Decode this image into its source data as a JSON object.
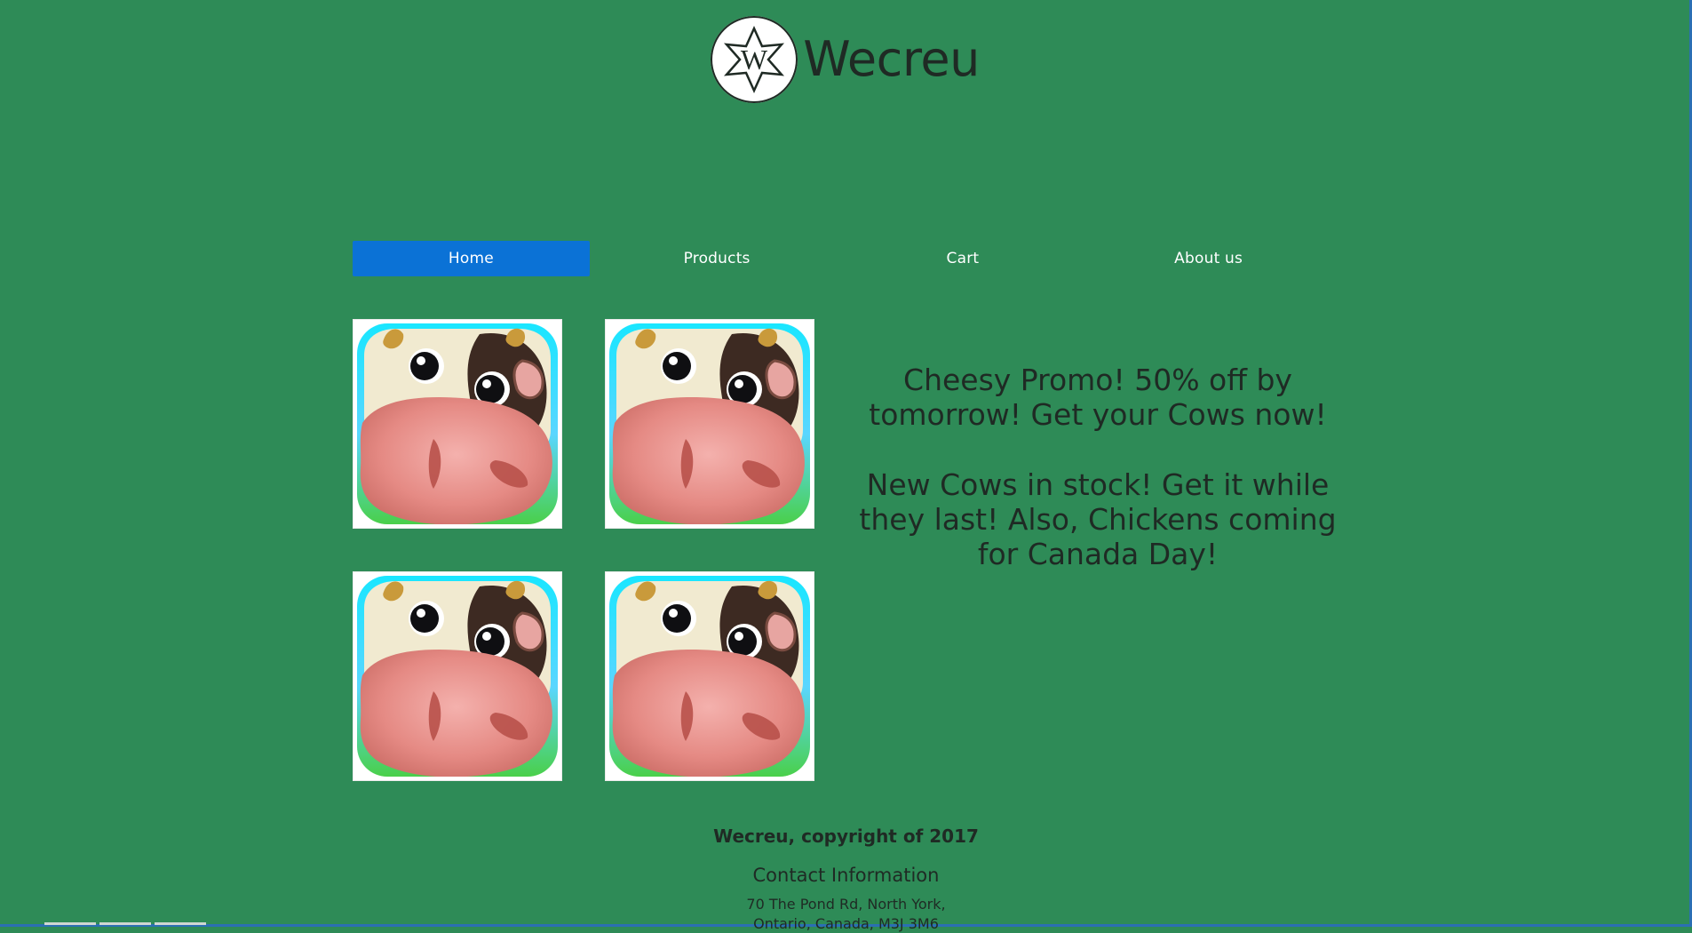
{
  "brand": {
    "name": "Wecreu",
    "logo_letter": "W"
  },
  "nav": {
    "items": [
      {
        "label": "Home"
      },
      {
        "label": "Products"
      },
      {
        "label": "Cart"
      },
      {
        "label": "About us"
      }
    ],
    "active_index": 0
  },
  "products": {
    "tiles": [
      {
        "icon": "cow-face-icon"
      },
      {
        "icon": "cow-face-icon"
      },
      {
        "icon": "cow-face-icon"
      },
      {
        "icon": "cow-face-icon"
      }
    ]
  },
  "promo": {
    "line1": "Cheesy Promo! 50% off by tomorrow! Get your Cows now!",
    "line2": "New Cows in stock! Get it while they last! Also, Chickens coming for Canada Day!"
  },
  "footer": {
    "copyright": "Wecreu, copyright of 2017",
    "contact_title": "Contact Information",
    "address_line1": "70 The Pond Rd, North York,",
    "address_line2": "Ontario, Canada, M3J 3M6"
  },
  "colors": {
    "page_background": "#2e8b57",
    "nav_active": "#0b72d6",
    "text_dark": "#1f2a24",
    "text_light": "#ffffff",
    "tile_background": "#ffffff",
    "window_border": "#2b6fb3"
  }
}
